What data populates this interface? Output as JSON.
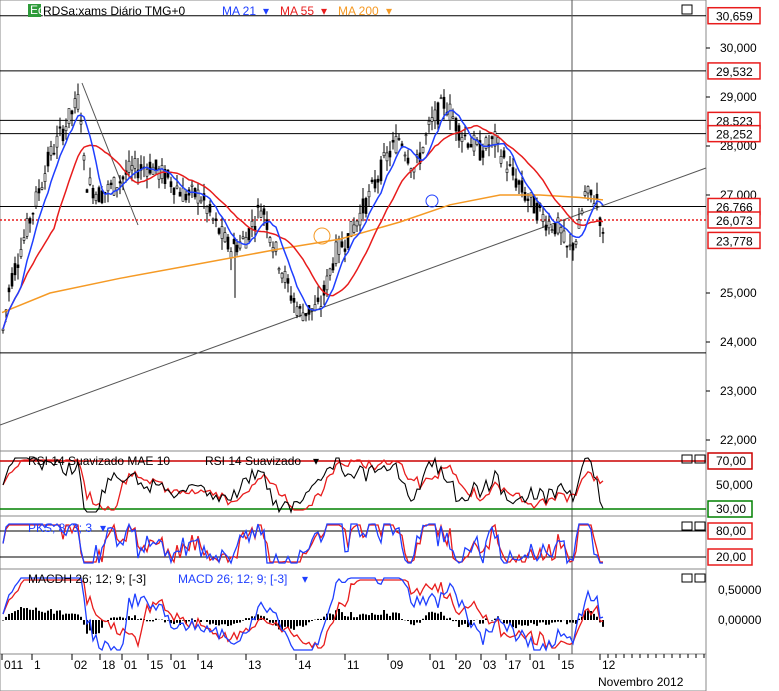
{
  "header": {
    "eq_icon": "Eq",
    "symbol": "RDSa:xams Diário TMG+0",
    "ma21": "MA 21",
    "ma55": "MA 55",
    "ma200": "MA 200"
  },
  "panels": {
    "rsi_label1": "RSI 14 Suavizado MAE 10",
    "rsi_label2": "RSI 14 Suavizado",
    "pks_label": "PKS; 8; 3; 3",
    "macd_label1": "MACDH 26; 12; 9; [-3]",
    "macd_label2": "MACD 26; 12; 9; [-3]"
  },
  "colors": {
    "ma21": "#1f3fff",
    "ma55": "#e81c1c",
    "ma200": "#f59a25",
    "price_badge": "#e81c1c",
    "rsi_high": "#cc0000",
    "rsi_low": "#008000"
  },
  "chart_data": [
    {
      "type": "candlestick",
      "title": "RDSa:xams Diário TMG+0",
      "ylim": [
        21.0,
        30.9
      ],
      "y_ticks": [
        "30,000",
        "29,000",
        "28,000",
        "27,000",
        "25,000",
        "24,000",
        "23,000",
        "22,000"
      ],
      "price_badges": [
        "30,659",
        "29,532",
        "28,523",
        "28,252",
        "26,766",
        "26,073",
        "23,778"
      ],
      "current_price": "26,073",
      "horizontal_levels": [
        30.659,
        29.532,
        28.523,
        28.252,
        26.766,
        23.778
      ],
      "x_ticks": [
        "011",
        "1",
        "02",
        "18",
        "01",
        "15",
        "01",
        "14",
        "13",
        "14",
        "11",
        "09",
        "01",
        "20",
        "03",
        "17",
        "01",
        "15",
        "12"
      ],
      "x_period_label": "Novembro 2012",
      "series": [
        {
          "name": "MA 21"
        },
        {
          "name": "MA 55"
        },
        {
          "name": "MA 200"
        }
      ]
    },
    {
      "type": "line",
      "title": "RSI 14 Suavizado MAE 10",
      "levels": [
        "70,00",
        "50,000",
        "30,00"
      ],
      "ylim": [
        20,
        80
      ],
      "series": [
        {
          "name": "RSI 14 Suavizado"
        }
      ]
    },
    {
      "type": "line",
      "title": "PKS; 8; 3; 3",
      "levels": [
        "80,00",
        "20,00"
      ],
      "ylim": [
        0,
        100
      ]
    },
    {
      "type": "bar",
      "title": "MACDH 26; 12; 9; [-3]",
      "y_ticks": [
        "0,50000",
        "0,00000"
      ],
      "series": [
        {
          "name": "MACD 26; 12; 9; [-3]"
        }
      ]
    }
  ]
}
